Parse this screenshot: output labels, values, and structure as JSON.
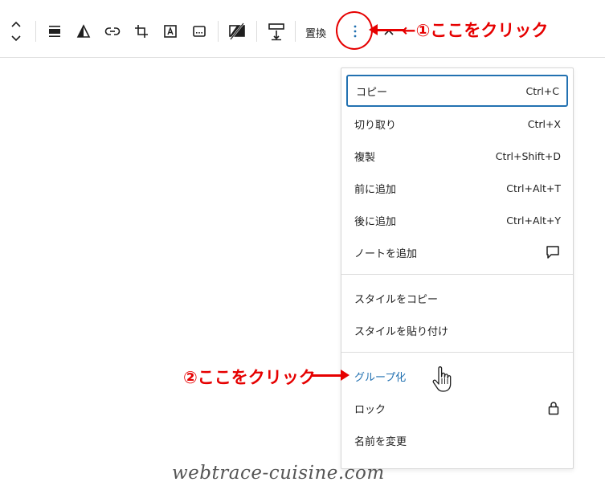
{
  "toolbar": {
    "replace_label": "置換",
    "icons": [
      "move-up-down-icon",
      "align-icon",
      "duotone-icon",
      "link-icon",
      "crop-icon",
      "text-overlay-icon",
      "alt-text-icon",
      "image-size-icon",
      "resize-icon",
      "more-options-icon",
      "collapse-icon"
    ]
  },
  "annotations": {
    "step1": "←①ここをクリック",
    "step2": "②ここをクリック",
    "color": "#e60000"
  },
  "menu": {
    "section1": [
      {
        "label": "コピー",
        "shortcut": "Ctrl+C"
      },
      {
        "label": "切り取り",
        "shortcut": "Ctrl+X"
      },
      {
        "label": "複製",
        "shortcut": "Ctrl+Shift+D"
      },
      {
        "label": "前に追加",
        "shortcut": "Ctrl+Alt+T"
      },
      {
        "label": "後に追加",
        "shortcut": "Ctrl+Alt+Y"
      },
      {
        "label": "ノートを追加",
        "icon": "comment-icon"
      }
    ],
    "section2": [
      {
        "label": "スタイルをコピー"
      },
      {
        "label": "スタイルを貼り付け"
      }
    ],
    "section3": [
      {
        "label": "グループ化"
      },
      {
        "label": "ロック",
        "icon": "lock-icon"
      },
      {
        "label": "名前を変更"
      }
    ]
  },
  "watermark": "webtrace-cuisine.com",
  "colors": {
    "accent": "#2271b1",
    "annotation": "#e60000"
  }
}
